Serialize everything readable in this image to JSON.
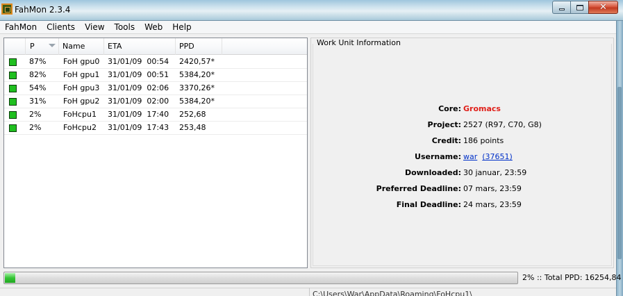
{
  "window": {
    "title": "FahMon 2.3.4",
    "controls": {
      "min": "minimize",
      "max": "maximize",
      "close": "✕"
    }
  },
  "menu": [
    "FahMon",
    "Clients",
    "View",
    "Tools",
    "Web",
    "Help"
  ],
  "list": {
    "columns": [
      "",
      "P",
      "Name",
      "ETA",
      "PPD"
    ],
    "sort_column": "P",
    "rows": [
      {
        "status_color": "#1fbf1f",
        "progress": "87%",
        "name": "FoH gpu0",
        "eta": "31/01/09  00:54",
        "ppd": "2420,57*"
      },
      {
        "status_color": "#1fbf1f",
        "progress": "82%",
        "name": "FoH gpu1",
        "eta": "31/01/09  00:51",
        "ppd": "5384,20*"
      },
      {
        "status_color": "#1fbf1f",
        "progress": "54%",
        "name": "FoH gpu3",
        "eta": "31/01/09  02:06",
        "ppd": "3370,26*"
      },
      {
        "status_color": "#1fbf1f",
        "progress": "31%",
        "name": "FoH gpu2",
        "eta": "31/01/09  02:00",
        "ppd": "5384,20*"
      },
      {
        "status_color": "#1fbf1f",
        "progress": "2%",
        "name": "FoHcpu1",
        "eta": "31/01/09  17:40",
        "ppd": "252,68"
      },
      {
        "status_color": "#1fbf1f",
        "progress": "2%",
        "name": "FoHcpu2",
        "eta": "31/01/09  17:43",
        "ppd": "253,48"
      }
    ]
  },
  "work_unit": {
    "title": "Work Unit Information",
    "core_label": "Core:",
    "core_value": "Gromacs",
    "project_label": "Project:",
    "project_value": "2527 (R97, C70, G8)",
    "credit_label": "Credit:",
    "credit_value": "186 points",
    "username_label": "Username:",
    "username_value": "war",
    "username_team": "(37651)",
    "downloaded_label": "Downloaded:",
    "downloaded_value": "30 januar, 23:59",
    "preferred_label": "Preferred Deadline:",
    "preferred_value": "07 mars, 23:59",
    "final_label": "Final Deadline:",
    "final_value": "24 mars, 23:59"
  },
  "progress": {
    "fraction": 0.02,
    "text": "2% :: Total PPD: 16254,84"
  },
  "status": {
    "path": "C:\\Users\\War\\AppData\\Roaming\\FoHcpu1\\"
  },
  "colors": {
    "accent": "#0030c8",
    "core": "#e0201a",
    "status_ok": "#1fbf1f"
  }
}
